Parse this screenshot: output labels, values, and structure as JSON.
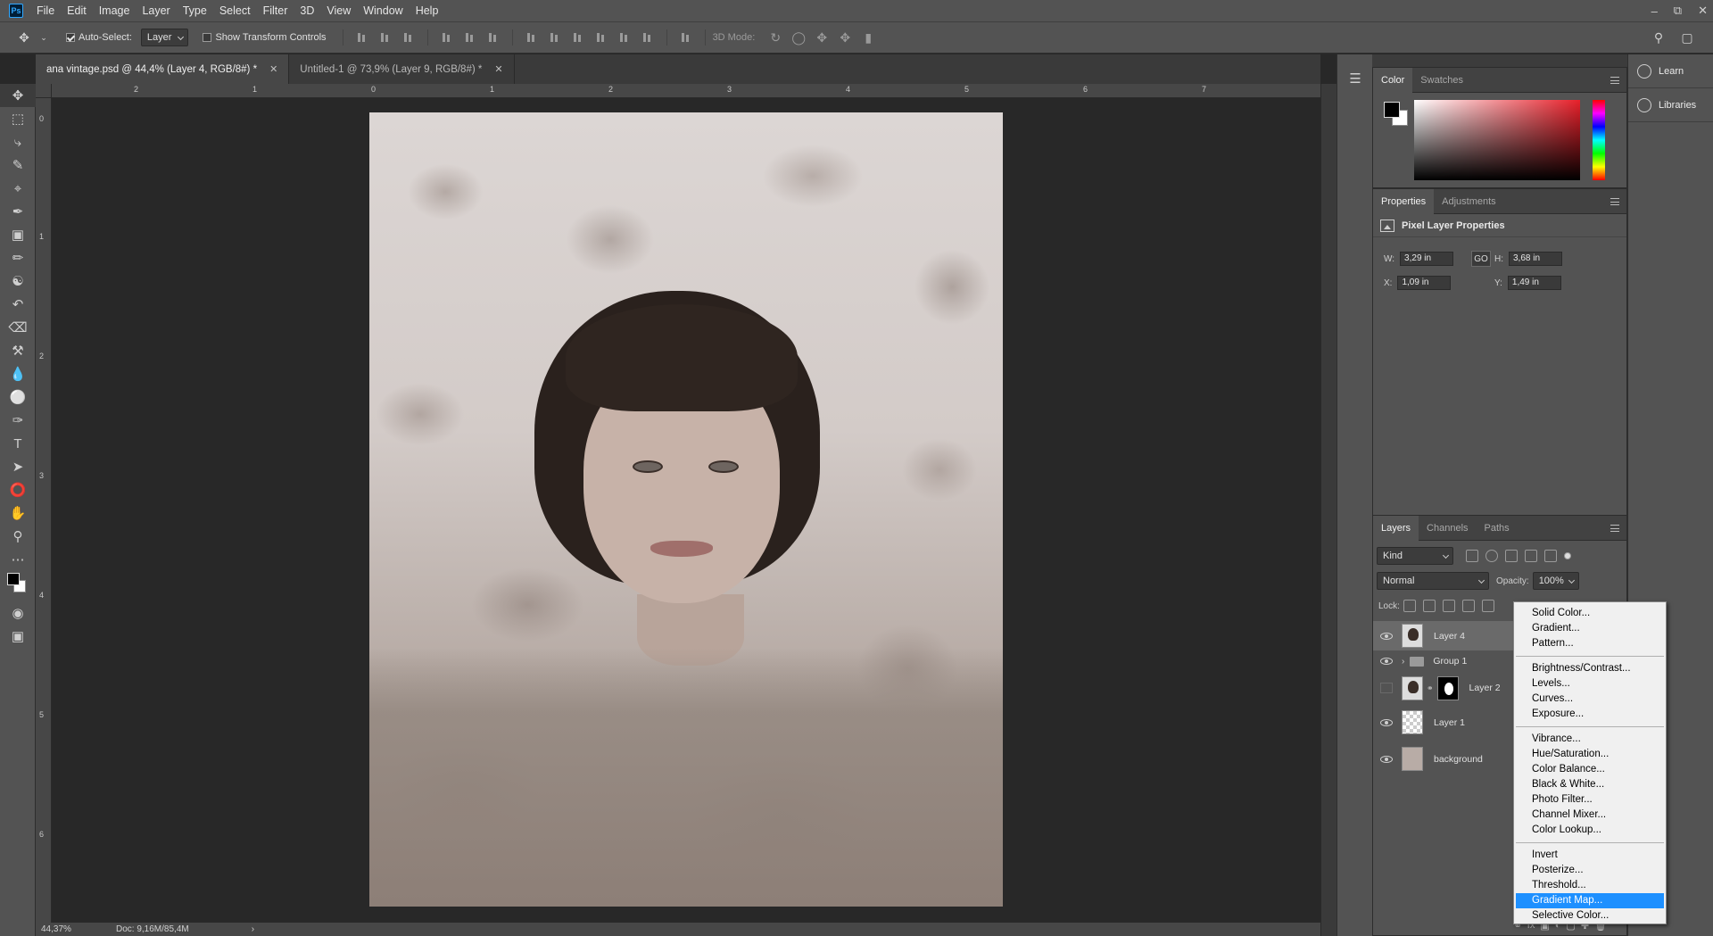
{
  "app": {
    "logo": "Ps"
  },
  "menu": [
    "File",
    "Edit",
    "Image",
    "Layer",
    "Type",
    "Select",
    "Filter",
    "3D",
    "View",
    "Window",
    "Help"
  ],
  "window_controls": [
    "minimize-icon",
    "restore-icon",
    "close-icon"
  ],
  "options": {
    "auto_select_label": "Auto-Select:",
    "auto_select_checked": true,
    "auto_select_target": "Layer",
    "transform_label": "Show Transform Controls",
    "mode_label": "3D Mode:"
  },
  "tabs": [
    {
      "label": "ana vintage.psd @ 44,4% (Layer 4, RGB/8#) *",
      "active": true
    },
    {
      "label": "Untitled-1 @ 73,9% (Layer 9, RGB/8#) *",
      "active": false
    }
  ],
  "ruler": {
    "top": [
      "2",
      "1",
      "0",
      "1",
      "2",
      "3",
      "4",
      "5",
      "6",
      "7"
    ],
    "left": [
      "0",
      "1",
      "2",
      "3",
      "4",
      "5",
      "6"
    ]
  },
  "status": {
    "zoom": "44,37%",
    "doc": "Doc: 9,16M/85,4M"
  },
  "color_panel": {
    "tabs": [
      "Color",
      "Swatches"
    ],
    "foreground": "#000000",
    "background": "#ffffff"
  },
  "properties": {
    "tabs": [
      "Properties",
      "Adjustments"
    ],
    "header": "Pixel Layer Properties",
    "w_label": "W:",
    "w_value": "3,29 in",
    "h_label": "H:",
    "h_value": "3,68 in",
    "x_label": "X:",
    "x_value": "1,09 in",
    "y_label": "Y:",
    "y_value": "1,49 in",
    "link_icon": "GO"
  },
  "layers": {
    "tabs": [
      "Layers",
      "Channels",
      "Paths"
    ],
    "filter": "Kind",
    "blend_mode": "Normal",
    "opacity_label": "Opacity:",
    "opacity_value": "100%",
    "lock_label": "Lock:",
    "items": [
      {
        "name": "Layer 4",
        "visible": true
      },
      {
        "name": "Group 1",
        "visible": true
      },
      {
        "name": "Layer 2",
        "visible": false
      },
      {
        "name": "Layer 1",
        "visible": true
      },
      {
        "name": "background",
        "visible": true
      }
    ]
  },
  "context_menu": {
    "groups": [
      [
        "Solid Color...",
        "Gradient...",
        "Pattern..."
      ],
      [
        "Brightness/Contrast...",
        "Levels...",
        "Curves...",
        "Exposure..."
      ],
      [
        "Vibrance...",
        "Hue/Saturation...",
        "Color Balance...",
        "Black & White...",
        "Photo Filter...",
        "Channel Mixer...",
        "Color Lookup..."
      ],
      [
        "Invert",
        "Posterize...",
        "Threshold...",
        "Gradient Map...",
        "Selective Color..."
      ]
    ],
    "highlighted": "Gradient Map..."
  },
  "right_panel": [
    "Learn",
    "Libraries"
  ]
}
